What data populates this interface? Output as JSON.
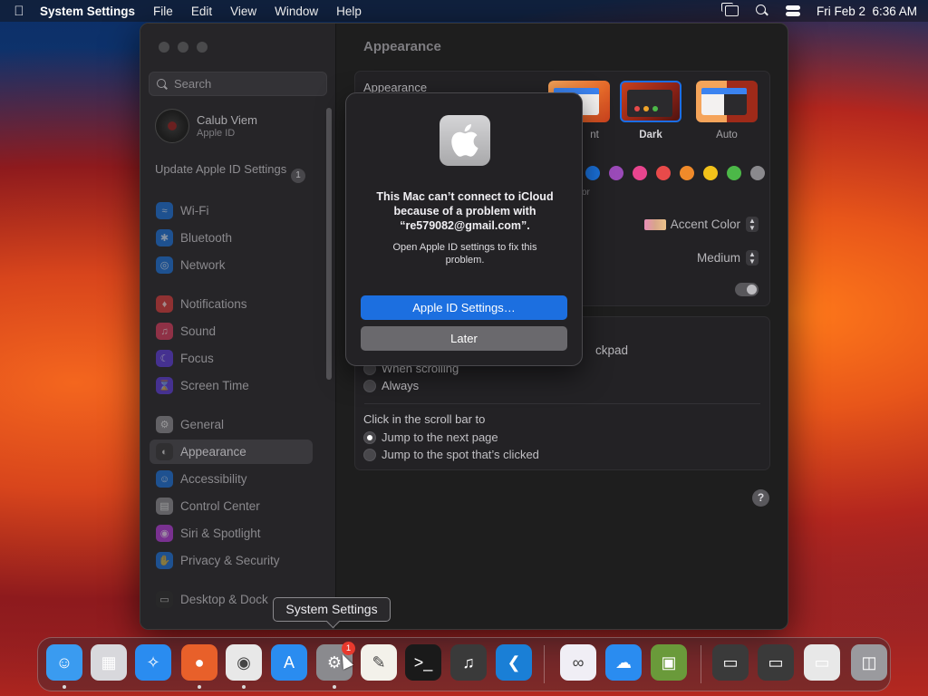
{
  "menubar": {
    "app_name": "System Settings",
    "menus": [
      "File",
      "Edit",
      "View",
      "Window",
      "Help"
    ],
    "datetime": "Fri Feb 2  6:36 AM"
  },
  "sidebar": {
    "search_placeholder": "Search",
    "account": {
      "name": "Calub Viem",
      "subtitle": "Apple ID"
    },
    "update": {
      "label": "Update Apple ID Settings",
      "badge": "1"
    },
    "items": [
      {
        "label": "Wi-Fi",
        "icon": "wifi-icon",
        "color": "#1a6fd6"
      },
      {
        "label": "Bluetooth",
        "icon": "bluetooth-icon",
        "color": "#1a6fd6"
      },
      {
        "label": "Network",
        "icon": "globe-icon",
        "color": "#1a6fd6"
      },
      {
        "label": "Notifications",
        "icon": "bell-icon",
        "color": "#d63a3a"
      },
      {
        "label": "Sound",
        "icon": "speaker-icon",
        "color": "#d63a5a"
      },
      {
        "label": "Focus",
        "icon": "moon-icon",
        "color": "#5a3ad6"
      },
      {
        "label": "Screen Time",
        "icon": "hourglass-icon",
        "color": "#5a3ad6"
      },
      {
        "label": "General",
        "icon": "gear-icon",
        "color": "#8a8a8e"
      },
      {
        "label": "Appearance",
        "icon": "appearance-icon",
        "color": "#2a2a2a"
      },
      {
        "label": "Accessibility",
        "icon": "accessibility-icon",
        "color": "#1a6fd6"
      },
      {
        "label": "Control Center",
        "icon": "control-center-icon",
        "color": "#8a8a8e"
      },
      {
        "label": "Siri & Spotlight",
        "icon": "siri-icon",
        "color": "#b03ad6"
      },
      {
        "label": "Privacy & Security",
        "icon": "hand-icon",
        "color": "#1a6fd6"
      },
      {
        "label": "Desktop & Dock",
        "icon": "dock-icon",
        "color": "#2a2a2a"
      }
    ],
    "active_item": "Appearance"
  },
  "main": {
    "title": "Appearance",
    "appearance_label": "Appearance",
    "themes": [
      {
        "label": "nt",
        "key": "light"
      },
      {
        "label": "Dark",
        "key": "dark"
      },
      {
        "label": "Auto",
        "key": "auto"
      }
    ],
    "selected_theme": "Dark",
    "accent_colors": [
      "#1a6fd6",
      "#9a4ab8",
      "#e8458e",
      "#e84a4a",
      "#f08a2a",
      "#f2c21a",
      "#4cb848",
      "#8a898d"
    ],
    "accent_fragment": "or",
    "highlight_color": {
      "label": "Accent Color"
    },
    "sidebar_icon_size": {
      "value": "Medium"
    },
    "scroll_fragment": "ckpad",
    "show_scroll_options": [
      {
        "label": "When scrolling",
        "selected": false
      },
      {
        "label": "Always",
        "selected": false
      }
    ],
    "click_scroll_label": "Click in the scroll bar to",
    "click_scroll_options": [
      {
        "label": "Jump to the next page",
        "selected": true
      },
      {
        "label": "Jump to the spot that’s clicked",
        "selected": false
      }
    ],
    "help": "?"
  },
  "dialog": {
    "title": "This Mac can’t connect to iCloud because of a problem with “re579082@gmail.com”.",
    "body": "Open Apple ID settings to fix this problem.",
    "primary_button": "Apple ID Settings…",
    "secondary_button": "Later"
  },
  "tooltip": "System Settings",
  "dock": {
    "apps": [
      {
        "name": "Finder",
        "icon": "finder-icon",
        "color": "#3a9bf0",
        "running": true
      },
      {
        "name": "Launchpad",
        "icon": "launchpad-icon",
        "color": "#d8d8dc",
        "running": false
      },
      {
        "name": "Safari",
        "icon": "safari-icon",
        "color": "#2a8cf0",
        "running": false
      },
      {
        "name": "Firefox",
        "icon": "firefox-icon",
        "color": "#e8602a",
        "running": true
      },
      {
        "name": "Chrome",
        "icon": "chrome-icon",
        "color": "#e8e8e8",
        "running": true
      },
      {
        "name": "App Store",
        "icon": "app-store-icon",
        "color": "#2a8cf0",
        "running": false
      },
      {
        "name": "System Settings",
        "icon": "gear-icon",
        "color": "#8a8a8e",
        "running": true,
        "badge": "1"
      },
      {
        "name": "TextEdit",
        "icon": "textedit-icon",
        "color": "#f3f1ea",
        "running": false
      },
      {
        "name": "Terminal",
        "icon": "terminal-icon",
        "color": "#1a1a1a",
        "running": false
      },
      {
        "name": "GarageBand",
        "icon": "guitar-icon",
        "color": "#3a3a3a",
        "running": false
      },
      {
        "name": "VS Code",
        "icon": "vscode-icon",
        "color": "#1a7fd6",
        "running": false
      },
      {
        "name": "Visual Studio",
        "icon": "visual-studio-icon",
        "color": "#f0eef5",
        "running": false
      },
      {
        "name": "Weather",
        "icon": "weather-icon",
        "color": "#2a8cf0",
        "running": false
      },
      {
        "name": "Minecraft",
        "icon": "minecraft-icon",
        "color": "#6a9a3a",
        "running": false
      },
      {
        "name": "Recent 1",
        "icon": "window-thumbnail-icon",
        "color": "#3a3a3a",
        "running": false
      },
      {
        "name": "Recent 2",
        "icon": "window-thumbnail-icon",
        "color": "#3a3a3a",
        "running": false
      },
      {
        "name": "Recent 3",
        "icon": "window-thumbnail-icon",
        "color": "#e8e8e8",
        "running": false
      },
      {
        "name": "Trash",
        "icon": "trash-icon",
        "color": "#9a9a9e",
        "running": false
      }
    ]
  }
}
